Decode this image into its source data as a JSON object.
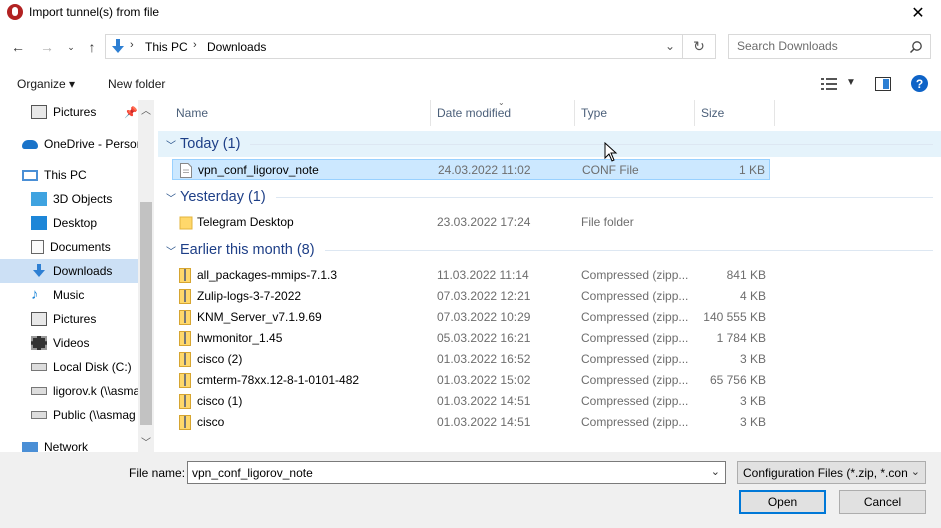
{
  "window": {
    "title": "Import tunnel(s) from file"
  },
  "nav": {
    "breadcrumbs": [
      "This PC",
      "Downloads"
    ],
    "search_placeholder": "Search Downloads"
  },
  "toolbar": {
    "organize": "Organize ▾",
    "new_folder": "New folder"
  },
  "sidebar": {
    "items": [
      {
        "label": "Pictures",
        "icon": "pictures-icon"
      },
      {
        "label": "OneDrive - Personal",
        "icon": "onedrive-icon"
      },
      {
        "label": "This PC",
        "icon": "computer-icon"
      },
      {
        "label": "3D Objects",
        "icon": "3d-objects-icon"
      },
      {
        "label": "Desktop",
        "icon": "desktop-icon"
      },
      {
        "label": "Documents",
        "icon": "documents-icon"
      },
      {
        "label": "Downloads",
        "icon": "downloads-icon"
      },
      {
        "label": "Music",
        "icon": "music-icon"
      },
      {
        "label": "Pictures",
        "icon": "pictures-icon"
      },
      {
        "label": "Videos",
        "icon": "videos-icon"
      },
      {
        "label": "Local Disk (C:)",
        "icon": "disk-icon"
      },
      {
        "label": "ligorov.k (\\\\asmag",
        "icon": "network-drive-icon"
      },
      {
        "label": "Public (\\\\asmag",
        "icon": "network-drive-icon"
      },
      {
        "label": "Network",
        "icon": "network-icon"
      }
    ]
  },
  "columns": {
    "name": "Name",
    "date": "Date modified",
    "type": "Type",
    "size": "Size"
  },
  "groups": {
    "today": "Today (1)",
    "yesterday": "Yesterday (1)",
    "earlier": "Earlier this month (8)"
  },
  "files": {
    "today": [
      {
        "name": "vpn_conf_ligorov_note",
        "date": "24.03.2022 11:02",
        "type": "CONF File",
        "size": "1 KB"
      }
    ],
    "yesterday": [
      {
        "name": "Telegram Desktop",
        "date": "23.03.2022 17:24",
        "type": "File folder",
        "size": ""
      }
    ],
    "earlier": [
      {
        "name": "all_packages-mmips-7.1.3",
        "date": "11.03.2022 11:14",
        "type": "Compressed (zipp...",
        "size": "841 KB"
      },
      {
        "name": "Zulip-logs-3-7-2022",
        "date": "07.03.2022 12:21",
        "type": "Compressed (zipp...",
        "size": "4 KB"
      },
      {
        "name": "KNM_Server_v7.1.9.69",
        "date": "07.03.2022 10:29",
        "type": "Compressed (zipp...",
        "size": "140 555 KB"
      },
      {
        "name": "hwmonitor_1.45",
        "date": "05.03.2022 16:21",
        "type": "Compressed (zipp...",
        "size": "1 784 KB"
      },
      {
        "name": "cisco (2)",
        "date": "01.03.2022 16:52",
        "type": "Compressed (zipp...",
        "size": "3 KB"
      },
      {
        "name": "cmterm-78xx.12-8-1-0101-482",
        "date": "01.03.2022 15:02",
        "type": "Compressed (zipp...",
        "size": "65 756 KB"
      },
      {
        "name": "cisco (1)",
        "date": "01.03.2022 14:51",
        "type": "Compressed (zipp...",
        "size": "3 KB"
      },
      {
        "name": "cisco",
        "date": "01.03.2022 14:51",
        "type": "Compressed (zipp...",
        "size": "3 KB"
      }
    ]
  },
  "footer": {
    "file_name_label": "File name:",
    "file_name_value": "vpn_conf_ligorov_note",
    "filter": "Configuration Files (*.zip, *.con",
    "open": "Open",
    "cancel": "Cancel"
  }
}
